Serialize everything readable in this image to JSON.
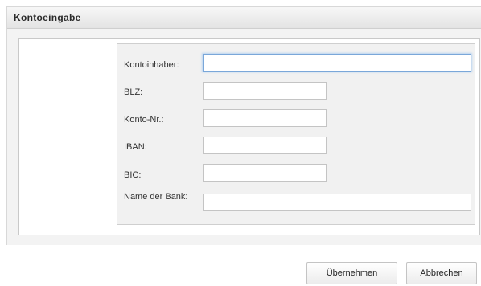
{
  "dialog": {
    "title": "Kontoeingabe"
  },
  "form": {
    "fields": [
      {
        "label": "Kontoinhaber:",
        "value": ""
      },
      {
        "label": "BLZ:",
        "value": ""
      },
      {
        "label": "Konto-Nr.:",
        "value": ""
      },
      {
        "label": "IBAN:",
        "value": ""
      },
      {
        "label": "BIC:",
        "value": ""
      },
      {
        "label": "Name der Bank:",
        "value": ""
      }
    ]
  },
  "buttons": {
    "apply_label": "Übernehmen",
    "cancel_label": "Abbrechen"
  }
}
